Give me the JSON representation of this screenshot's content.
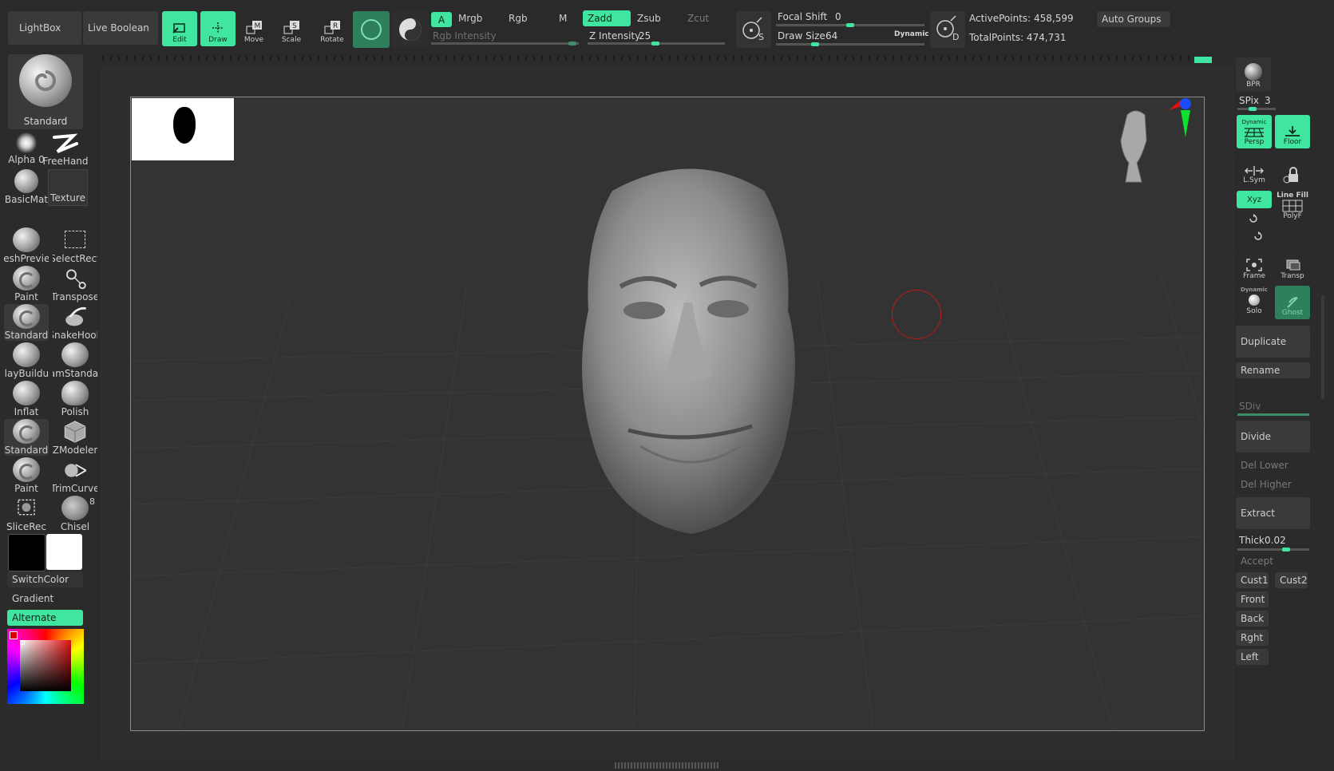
{
  "top": {
    "lightbox": "LightBox",
    "live_boolean": "Live Boolean",
    "tools": [
      {
        "label": "Edit",
        "icon": "edit-icon",
        "active": true
      },
      {
        "label": "Draw",
        "icon": "draw-icon",
        "active": true
      },
      {
        "label": "Move",
        "icon": "move-icon",
        "active": false
      },
      {
        "label": "Scale",
        "icon": "scale-icon",
        "active": false
      },
      {
        "label": "Rotate",
        "icon": "rotate-icon",
        "active": false
      }
    ],
    "a_label": "A",
    "mrgb": "Mrgb",
    "rgb": "Rgb",
    "m": "M",
    "zadd": "Zadd",
    "zsub": "Zsub",
    "zcut": "Zcut",
    "rgb_intensity": "Rgb Intensity",
    "z_intensity_label": "Z Intensity",
    "z_intensity_value": "25",
    "focal_shift_label": "Focal Shift",
    "focal_shift_value": "0",
    "draw_size_label": "Draw Size",
    "draw_size_value": "64",
    "dynamic": "Dynamic",
    "s_label": "S",
    "d_label": "D",
    "active_points": "ActivePoints: 458,599",
    "total_points": "TotalPoints: 474,731",
    "auto_groups": "Auto Groups"
  },
  "left": {
    "current_brush": "Standard",
    "alpha": "Alpha 0",
    "stroke": "FreeHand",
    "material": "BasicMat",
    "texture": "Texture",
    "brushes": [
      [
        "MeshPreview",
        "SelectRect"
      ],
      [
        "Paint",
        "Transpose"
      ],
      [
        "Standard",
        "SnakeHook"
      ],
      [
        "ClayBuildup",
        "DamStandard"
      ],
      [
        "Inflat",
        "Polish"
      ],
      [
        "Standard",
        "ZModeler"
      ],
      [
        "Paint",
        "TrimCurve"
      ],
      [
        "SliceRec",
        "Chisel"
      ]
    ],
    "chisel_badge": "8",
    "switch_color": "SwitchColor",
    "gradient": "Gradient",
    "alternate": "Alternate",
    "colors": {
      "main": "#000000",
      "secondary": "#ffffff",
      "accent": "#40e6a0"
    }
  },
  "right": {
    "bpr": "BPR",
    "spix_label": "SPix",
    "spix_value": "3",
    "persp": "Persp",
    "floor": "Floor",
    "lsym": "L.Sym",
    "xyz": "Xyz",
    "line_fill": "Line Fill",
    "polyf": "PolyF",
    "frame": "Frame",
    "transp": "Transp",
    "dynamic": "Dynamic",
    "solo": "Solo",
    "ghost": "Ghost",
    "duplicate": "Duplicate",
    "rename": "Rename",
    "sdiv": "SDiv",
    "divide": "Divide",
    "del_lower": "Del Lower",
    "del_higher": "Del Higher",
    "extract": "Extract",
    "thick_label": "Thick",
    "thick_value": "0.02",
    "accept": "Accept",
    "cust1": "Cust1",
    "cust2": "Cust2",
    "front": "Front",
    "back": "Back",
    "right_view": "Rght",
    "left_view": "Left"
  }
}
